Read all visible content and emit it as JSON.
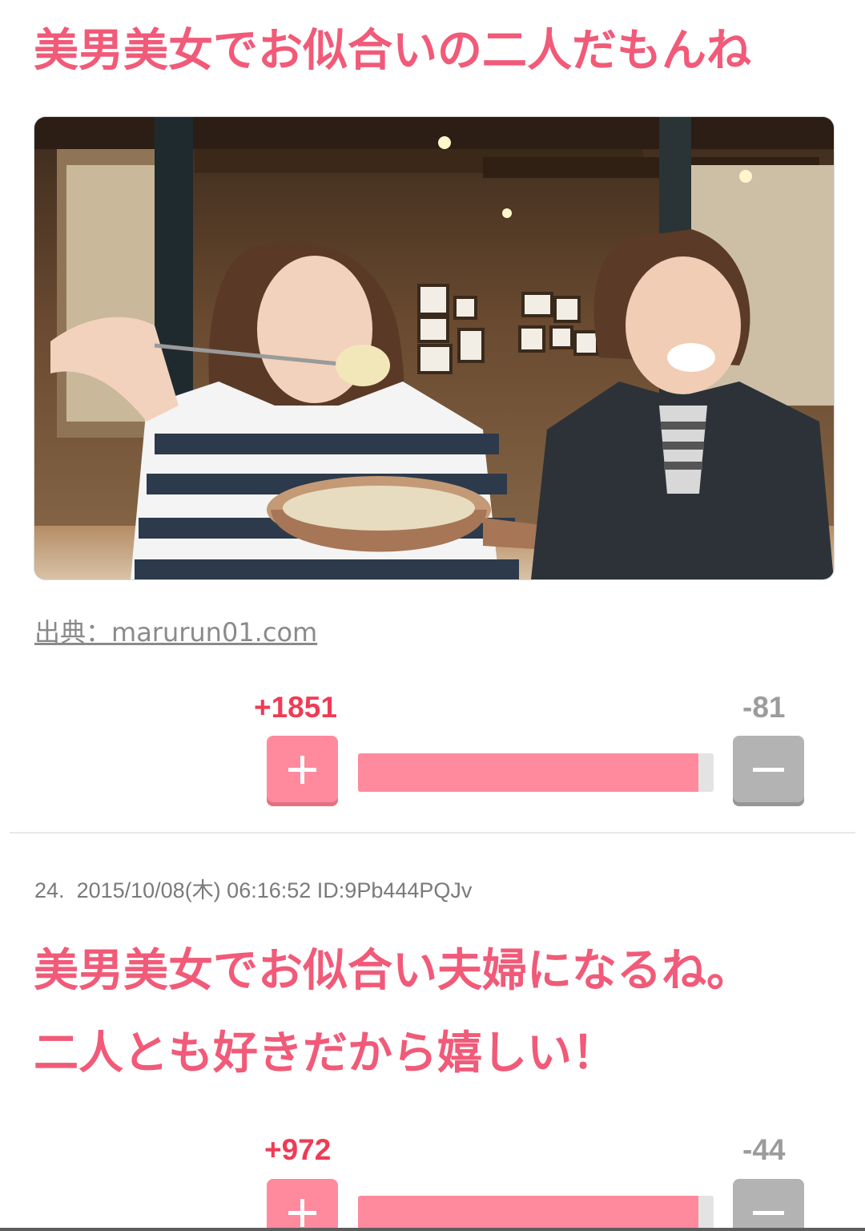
{
  "comments": [
    {
      "text": "美男美女でお似合いの二人だもんね",
      "source_label": "出典：",
      "source_domain": "marurun01.com",
      "votes": {
        "plus": "+1851",
        "minus": "-81",
        "ratio": 0.958
      }
    },
    {
      "number": "24.",
      "datetime": "2015/10/08(木) 06:16:52",
      "user_id": "ID:9Pb444PQJv",
      "text_line1": "美男美女でお似合い夫婦になるね。",
      "text_line2": "二人とも好きだから嬉しい！",
      "votes": {
        "plus": "+972",
        "minus": "-44",
        "ratio": 0.957
      }
    }
  ],
  "icons": {
    "plus": "plus-icon",
    "minus": "minus-icon"
  },
  "colors": {
    "accent_text": "#f15a78",
    "plus_button": "#ff8a9d",
    "minus_button": "#b3b3b3",
    "plus_count": "#ef3b55",
    "minus_count": "#9c9c9c"
  }
}
